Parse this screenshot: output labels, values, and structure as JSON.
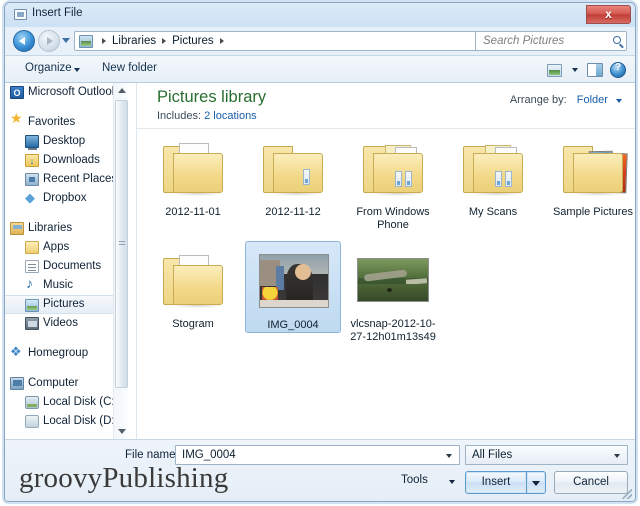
{
  "window": {
    "title": "Insert File",
    "title_icon": "file-dialog-icon",
    "close_label": "x"
  },
  "nav": {
    "back_icon": "back-arrow-icon",
    "forward_icon": "forward-arrow-icon",
    "history_icon": "history-dropdown-icon",
    "address_icon": "pictures-library-icon",
    "breadcrumbs": [
      "Libraries",
      "Pictures"
    ],
    "address_dropdown_icon": "chevron-down-icon",
    "refresh_icon": "refresh-icon",
    "refresh_glyph": "↻"
  },
  "search": {
    "placeholder": "Search Pictures",
    "icon": "search-icon"
  },
  "toolbar": {
    "organize_label": "Organize",
    "organize_caret_icon": "chevron-down-icon",
    "new_folder_label": "New folder",
    "view_icon": "change-view-icon",
    "view_caret_icon": "chevron-down-icon",
    "preview_pane_icon": "preview-pane-icon",
    "help_icon": "help-icon",
    "help_glyph": "?"
  },
  "sidebar": {
    "items": [
      {
        "label": "Microsoft Outlook",
        "icon": "outlook-icon",
        "level": 0,
        "selected": false
      },
      {
        "label": "",
        "icon": "",
        "level": -1,
        "selected": false
      },
      {
        "label": "Favorites",
        "icon": "favorites-star-icon",
        "level": 0,
        "selected": false
      },
      {
        "label": "Desktop",
        "icon": "desktop-icon",
        "level": 1,
        "selected": false
      },
      {
        "label": "Downloads",
        "icon": "downloads-icon",
        "level": 1,
        "selected": false
      },
      {
        "label": "Recent Places",
        "icon": "recent-places-icon",
        "level": 1,
        "selected": false
      },
      {
        "label": "Dropbox",
        "icon": "dropbox-icon",
        "level": 1,
        "selected": false
      },
      {
        "label": "",
        "icon": "",
        "level": -1,
        "selected": false
      },
      {
        "label": "Libraries",
        "icon": "libraries-icon",
        "level": 0,
        "selected": false
      },
      {
        "label": "Apps",
        "icon": "folder-icon",
        "level": 1,
        "selected": false
      },
      {
        "label": "Documents",
        "icon": "documents-icon",
        "level": 1,
        "selected": false
      },
      {
        "label": "Music",
        "icon": "music-icon",
        "level": 1,
        "selected": false
      },
      {
        "label": "Pictures",
        "icon": "pictures-icon",
        "level": 1,
        "selected": true
      },
      {
        "label": "Videos",
        "icon": "videos-icon",
        "level": 1,
        "selected": false
      },
      {
        "label": "",
        "icon": "",
        "level": -1,
        "selected": false
      },
      {
        "label": "Homegroup",
        "icon": "homegroup-icon",
        "level": 0,
        "selected": false
      },
      {
        "label": "",
        "icon": "",
        "level": -1,
        "selected": false
      },
      {
        "label": "Computer",
        "icon": "computer-icon",
        "level": 0,
        "selected": false
      },
      {
        "label": "Local Disk (C:)",
        "icon": "local-disk-system-icon",
        "level": 1,
        "selected": false
      },
      {
        "label": "Local Disk (D:)",
        "icon": "local-disk-icon",
        "level": 1,
        "selected": false
      }
    ],
    "scrollbar": {
      "up_icon": "scroll-up-icon",
      "down_icon": "scroll-down-icon"
    }
  },
  "library": {
    "title": "Pictures library",
    "includes_label": "Includes:",
    "includes_value": "2 locations",
    "arrange_label": "Arrange by:",
    "arrange_value": "Folder",
    "arrange_caret_icon": "chevron-down-icon"
  },
  "files": [
    {
      "name": "2012-11-01",
      "kind": "folder-with-document",
      "selected": false
    },
    {
      "name": "2012-11-12",
      "kind": "folder-with-tab",
      "selected": false
    },
    {
      "name": "From Windows Phone",
      "kind": "folder-multi",
      "selected": false
    },
    {
      "name": "My Scans",
      "kind": "folder-multi",
      "selected": false
    },
    {
      "name": "Sample Pictures",
      "kind": "folder-photos",
      "selected": false
    },
    {
      "name": "Stogram",
      "kind": "folder-with-document",
      "selected": false
    },
    {
      "name": "IMG_0004",
      "kind": "photo-img0004",
      "selected": true
    },
    {
      "name": "vlcsnap-2012-10-27-12h01m13s49",
      "kind": "photo-vlc",
      "selected": false
    }
  ],
  "footer": {
    "file_name_label": "File name:",
    "file_name_value": "IMG_0004",
    "file_name_caret_icon": "chevron-down-icon",
    "file_type_value": "All Files",
    "file_type_caret_icon": "chevron-down-icon",
    "tools_label": "Tools",
    "tools_caret_icon": "chevron-down-icon",
    "insert_label": "Insert",
    "insert_caret_icon": "chevron-down-icon",
    "cancel_label": "Cancel",
    "resize_grip_icon": "resize-grip-icon"
  },
  "watermark": {
    "text": "groovyPublishing"
  },
  "colors": {
    "accent_blue": "#1a5fa8",
    "library_green": "#2a6e2f",
    "selection_blue": "#bfd9f0",
    "close_red": "#c03f38"
  }
}
